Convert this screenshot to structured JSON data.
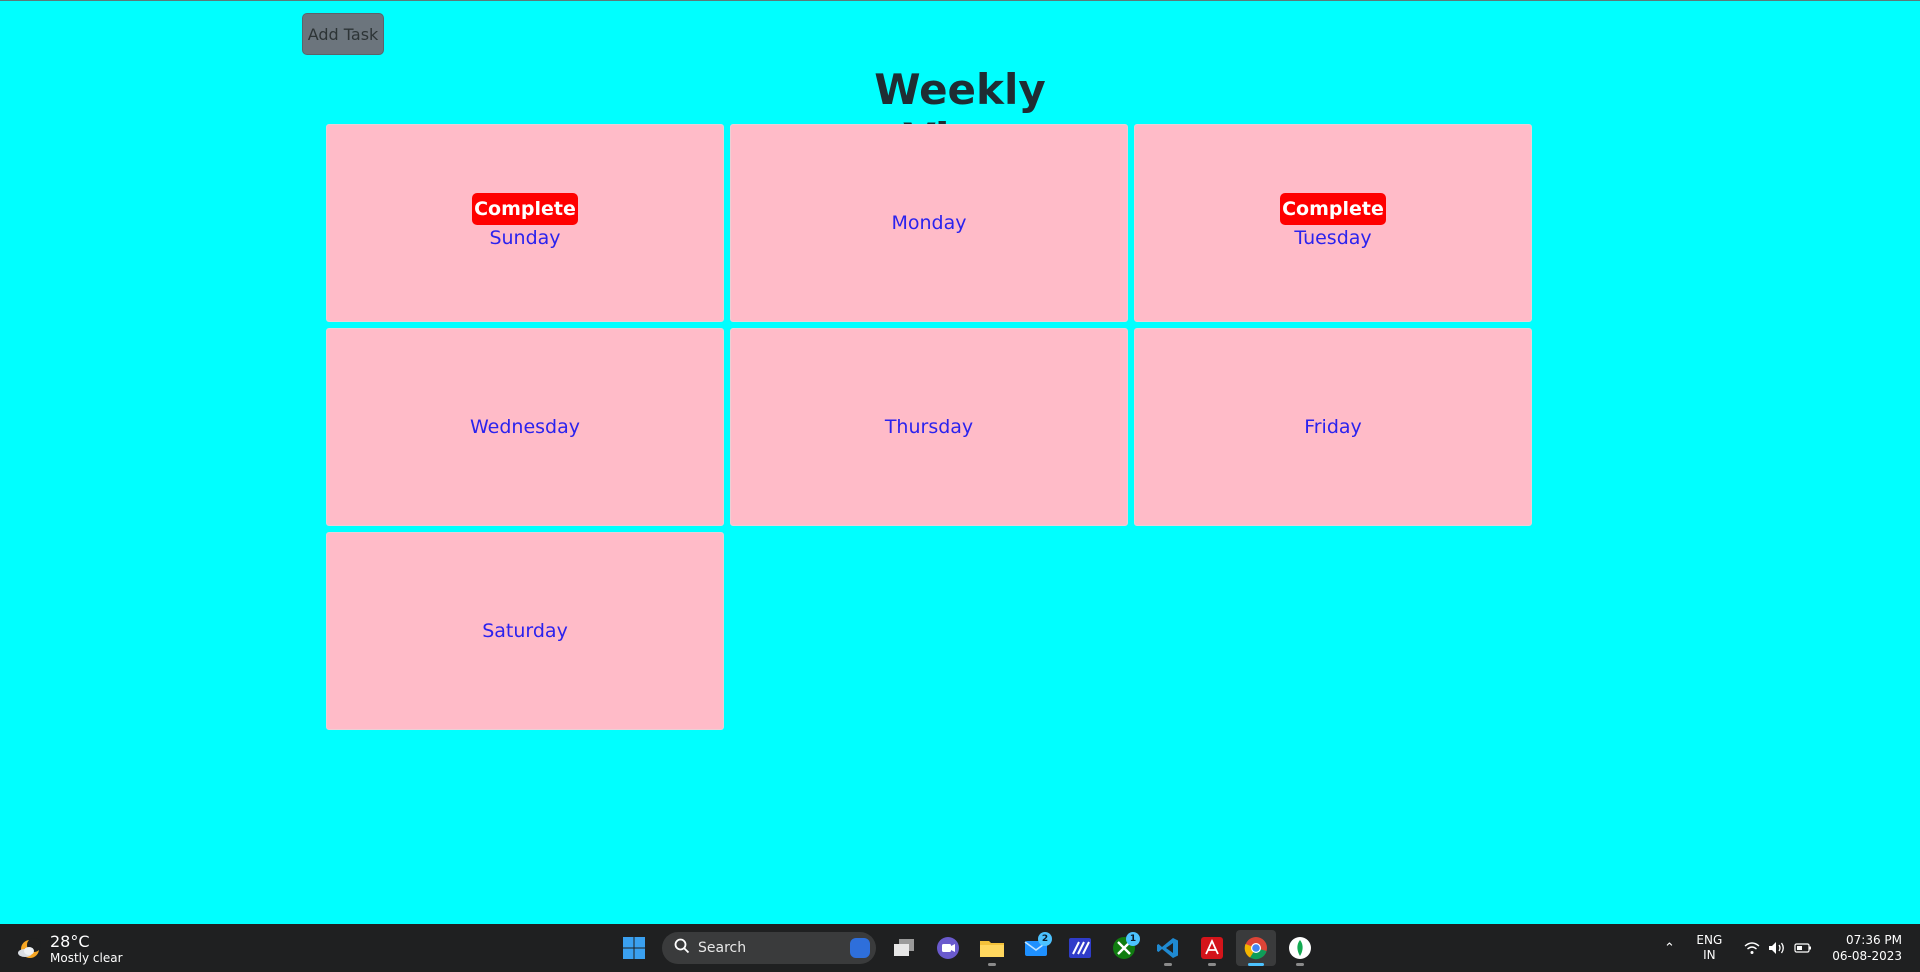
{
  "app": {
    "add_task_label": "Add Task",
    "title": "Weekly View",
    "days": [
      {
        "label": "Sunday",
        "badge": "Complete"
      },
      {
        "label": "Monday",
        "badge": ""
      },
      {
        "label": "Tuesday",
        "badge": "Complete"
      },
      {
        "label": "Wednesday",
        "badge": ""
      },
      {
        "label": "Thursday",
        "badge": ""
      },
      {
        "label": "Friday",
        "badge": ""
      },
      {
        "label": "Saturday",
        "badge": ""
      }
    ]
  },
  "colors": {
    "background": "#00ffff",
    "card": "#ffbbc8",
    "badge": "#ff0000",
    "day_text": "#2b22ee",
    "button": "#6c757d"
  },
  "taskbar": {
    "weather": {
      "temp": "28°C",
      "desc": "Mostly clear",
      "icon": "moon-cloud-icon"
    },
    "search_placeholder": "Search",
    "apps": [
      {
        "name": "start-icon"
      },
      {
        "name": "task-view-icon"
      },
      {
        "name": "teams-meet-icon"
      },
      {
        "name": "file-explorer-icon"
      },
      {
        "name": "mail-icon",
        "badge": "2"
      },
      {
        "name": "app-blue-icon"
      },
      {
        "name": "xbox-icon",
        "badge": "1"
      },
      {
        "name": "vscode-icon"
      },
      {
        "name": "acrobat-icon"
      },
      {
        "name": "chrome-icon"
      },
      {
        "name": "mongodb-compass-icon"
      }
    ],
    "lang_line1": "ENG",
    "lang_line2": "IN",
    "time": "07:36 PM",
    "date": "06-08-2023"
  }
}
